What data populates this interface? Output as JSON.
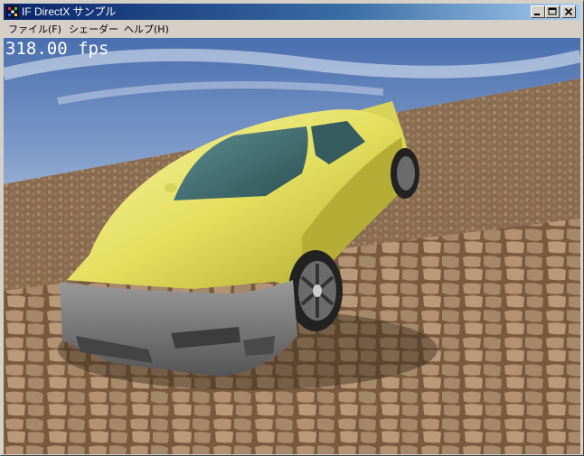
{
  "window": {
    "title": "IF DirectX サンプル",
    "controls": {
      "minimize_icon": "minimize-icon",
      "maximize_icon": "maximize-icon",
      "close_icon": "close-icon"
    }
  },
  "menu": {
    "items": [
      {
        "label": "ファイル(F)"
      },
      {
        "label": "シェーダー"
      },
      {
        "label": "ヘルプ(H)"
      }
    ]
  },
  "viewport": {
    "fps_text": "318.00 fps",
    "scene_content": "yellow sports car on cobblestone ground under blue sky"
  },
  "colors": {
    "title_gradient_start": "#0a246a",
    "title_gradient_end": "#a6caf0",
    "window_face": "#d4d0c8",
    "car_body": "#e7e16a",
    "sky": "#5d7fb8",
    "ground": "#8a6a4a"
  }
}
